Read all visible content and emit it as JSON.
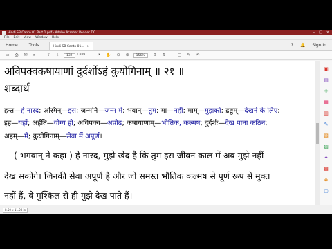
{
  "window": {
    "title": "Hindi SB Canto 01 Part 1.pdf - Adobe Acrobat Reader DC",
    "controls": [
      "–",
      "□",
      "×"
    ]
  },
  "menu": [
    "File",
    "Edit",
    "View",
    "Window",
    "Help"
  ],
  "tabs": {
    "home": "Home",
    "tools": "Tools",
    "document": "Hindi SB Canto 01...",
    "document_close": "×",
    "right_icons": [
      "?",
      "🔔"
    ],
    "signin": "Sign In"
  },
  "toolbar": {
    "page_current": "132",
    "page_total": "/ 889",
    "zoom": "156%",
    "icons": [
      "save-icon",
      "print-icon",
      "mail-icon",
      "search-icon",
      "page-up-icon",
      "page-down-icon",
      "select-icon",
      "hand-icon",
      "zoom-out-icon",
      "zoom-in-icon",
      "fit-icon",
      "scroll-icon",
      "comment-icon",
      "draw-icon",
      "sign-icon"
    ]
  },
  "statusbar": {
    "page_size": "8.50 x 11.00 in"
  },
  "colors": {
    "title_bar": "#8a1f1f",
    "synonym_english": "#1a1aa0",
    "right_panel_icons": [
      "#d9342b",
      "#7b3fb8",
      "#2e9e4a",
      "#e0245e",
      "#d9342b",
      "#3a7bd5",
      "#e07b00",
      "#2e9e4a",
      "#7b3fb8",
      "#d9342b",
      "#e07b00",
      "#3a7bd5"
    ]
  },
  "document": {
    "verse": "अविपक्वकषायाणां दुर्दर्शोऽहं कुयोगिनाम् ॥ २१ ॥",
    "heading": "शब्दार्थ",
    "synonyms_line1": [
      {
        "s": "हन्त",
        "e": "हे नारद"
      },
      {
        "s": "अस्मिन्",
        "e": "इस"
      },
      {
        "s": "जन्मनि",
        "e": "जन्म में"
      },
      {
        "s": "भवान्",
        "e": "तुम"
      },
      {
        "s": "मा",
        "e": "नहीं"
      },
      {
        "s": "माम्",
        "e": "मुझको"
      },
      {
        "s": "द्रष्टुम्",
        "e": "देखने के लिए"
      }
    ],
    "synonyms_line2": [
      {
        "s": "इह",
        "e": "यहाँ"
      },
      {
        "s": "अर्हति",
        "e": "योग्य हो"
      },
      {
        "s": "अविपक्व",
        "e": "अप्रौढ़"
      },
      {
        "s": "कषायाणाम्",
        "e": "भौतिक, कल्मष"
      },
      {
        "s": "दुर्दर्शः",
        "e": "देख पाना कठिन"
      }
    ],
    "synonyms_line3": [
      {
        "s": "अहम्",
        "e": "मैं"
      },
      {
        "s": "कुयोगिनाम्",
        "e": "सेवा में अपूर्ण"
      }
    ],
    "translation_line1": "( भगवान् ने कहा ) हे नारद, मुझे खेद है कि तुम इस जीवन काल में अब मुझे नहीं",
    "translation_line2": "देख सकोगे। जिनकी सेवा अपूर्ण है और जो समस्त भौतिक कल्मष से पूर्ण रूप से मुक्त",
    "translation_line3": "नहीं हैं, वे मुश्किल से ही मुझे देख पाते हैं।"
  }
}
